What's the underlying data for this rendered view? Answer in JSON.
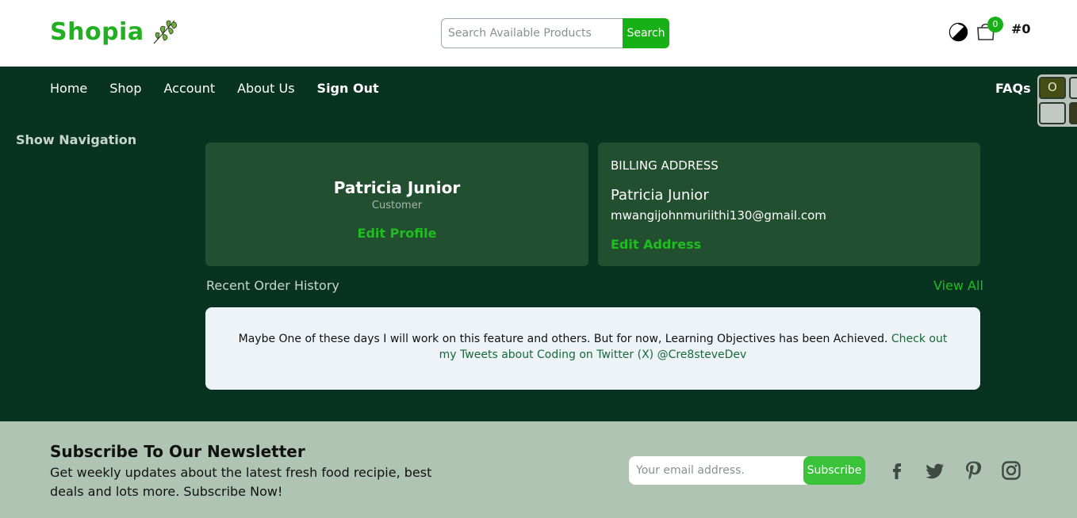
{
  "header": {
    "logo_text": "Shopia",
    "search_placeholder": "Search Available Products",
    "search_button": "Search",
    "cart_count": "0",
    "order_count": "#0"
  },
  "nav": {
    "items": [
      "Home",
      "Shop",
      "Account",
      "About Us",
      "Sign Out"
    ],
    "faqs": "FAQs",
    "show_navigation": "Show Navigation",
    "widget_glyph": "O"
  },
  "profile": {
    "name": "Patricia Junior",
    "role": "Customer",
    "edit_label": "Edit Profile"
  },
  "billing": {
    "title": "BILLING ADDRESS",
    "name": "Patricia Junior",
    "email": "mwangijohnmuriithi130@gmail.com",
    "edit_label": "Edit Address"
  },
  "orders": {
    "title": "Recent Order History",
    "view_all": "View All",
    "notice_text": "Maybe One of these days I will work on this feature and others. But for now, Learning Objectives has been Achieved. ",
    "notice_link": "Check out my Tweets about Coding on Twitter (X) @Cre8steveDev"
  },
  "footer": {
    "newsletter_title": "Subscribe To Our Newsletter",
    "newsletter_desc": "Get weekly updates about the latest fresh food recipie, best deals and lots more. Subscribe Now!",
    "email_placeholder": "Your email address.",
    "subscribe_button": "Subscribe",
    "social_icons": [
      "facebook-icon",
      "twitter-icon",
      "pinterest-icon",
      "instagram-icon"
    ]
  },
  "colors": {
    "brand_green": "#17b117",
    "page_bg": "#073320",
    "card_bg": "#234f31",
    "footer_bg": "#b0c4b4"
  }
}
